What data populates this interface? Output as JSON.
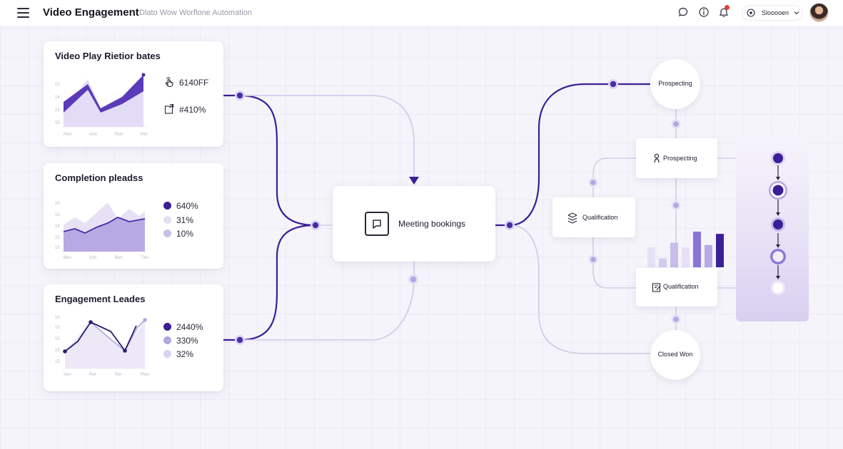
{
  "header": {
    "title": "Video Engagement",
    "subtitle": "Dlato Wow Worflone Automation",
    "user_name": "Slooooen"
  },
  "cards": {
    "play_rate": {
      "title": "Video Play Rietior bates",
      "stats": [
        {
          "icon": "hand-pointer-icon",
          "value": "6140FF"
        },
        {
          "icon": "share-box-icon",
          "value": "#410%"
        }
      ],
      "chart": {
        "type": "area",
        "x_labels": [
          "Ren",
          "Arm",
          "Rrm",
          "Rer"
        ],
        "series": [
          {
            "values": [
              35,
              62,
              38,
              53,
              68
            ],
            "color": "#4a2ca8"
          },
          {
            "values": [
              30,
              50,
              30,
              45,
              62
            ],
            "color": "#c9bdf0"
          }
        ],
        "ylim": [
          0,
          75
        ]
      }
    },
    "completion": {
      "title": "Completion pleadss",
      "legend": [
        {
          "value": "640%",
          "color": "#3b1f96"
        },
        {
          "value": "31%",
          "color": "#e4e1ef"
        },
        {
          "value": "10%",
          "color": "#c8c0e8"
        }
      ],
      "chart": {
        "type": "area",
        "x_labels": [
          "Ben",
          "2on",
          "Ben",
          "Tien"
        ],
        "series": [
          {
            "values": [
              20,
              35,
              28,
              42,
              30,
              40,
              32,
              38
            ],
            "color": "#dcd5f3"
          },
          {
            "values": [
              12,
              18,
              10,
              16,
              22,
              28,
              24,
              27
            ],
            "color": "#4a2ca8"
          }
        ],
        "ylim": [
          0,
          50
        ]
      }
    },
    "engagement": {
      "title": "Engagement Leades",
      "legend": [
        {
          "value": "2440%",
          "color": "#3b1f96"
        },
        {
          "value": "330%",
          "color": "#b3a7e0"
        },
        {
          "value": "32%",
          "color": "#d9d4ee"
        }
      ],
      "chart": {
        "type": "line",
        "x_labels": [
          "Sen",
          "Rer",
          "Rer",
          "Rien"
        ],
        "series": [
          {
            "values": [
              10,
              18,
              46,
              32,
              12,
              40,
              46
            ],
            "color": "#2a1d6e"
          },
          {
            "values": [
              8,
              20,
              42,
              40,
              30,
              38,
              48
            ],
            "color": "#b3a7e0"
          }
        ],
        "ylim": [
          0,
          55
        ]
      }
    }
  },
  "flow": {
    "center_label": "Meeting bookings",
    "nodes": {
      "prospecting_circle": "Prospecting",
      "prospecting_box": "Prospecting",
      "qualification_left": "Qualification",
      "qualification_box": "Qualification",
      "closed_won": "Closed Won"
    },
    "bar_values": [
      45,
      20,
      55,
      45,
      80,
      50,
      75
    ],
    "colors": {
      "accent": "#3b1f96",
      "accent_light": "#7a62d4",
      "line_light": "#d3cde8"
    }
  }
}
